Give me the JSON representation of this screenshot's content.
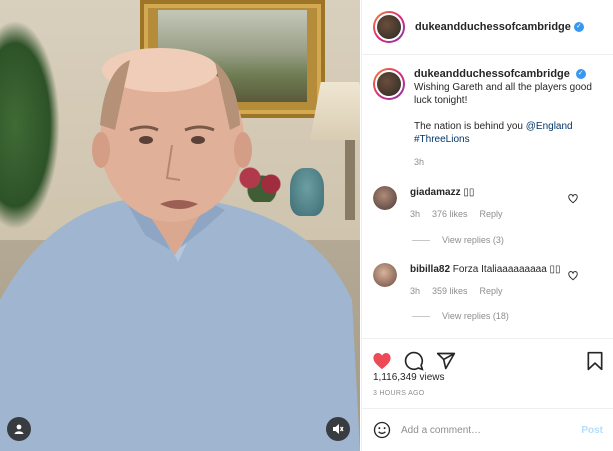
{
  "post": {
    "author": "dukeandduchessofcambridge",
    "caption_line1": "Wishing Gareth and all the players good luck tonight!",
    "caption_line2_text": "The nation is behind you ",
    "caption_mention": "@England",
    "caption_hashtag": "#ThreeLions",
    "caption_time": "3h",
    "views": "1,116,349 views",
    "time_ago": "3 HOURS AGO"
  },
  "comments": [
    {
      "user": "giadamazz",
      "text": "▯▯",
      "time": "3h",
      "likes": "376 likes",
      "reply_label": "Reply",
      "view_replies": "View replies (3)"
    },
    {
      "user": "bibilla82",
      "text": "Forza Italiaaaaaaaaa ▯▯",
      "time": "3h",
      "likes": "359 likes",
      "reply_label": "Reply",
      "view_replies": "View replies (18)"
    }
  ],
  "composer": {
    "placeholder": "Add a comment…",
    "post_label": "Post"
  },
  "icons": {
    "like": "heart-icon",
    "comment": "comment-icon",
    "share": "share-icon",
    "save": "bookmark-icon",
    "emoji": "emoji-icon",
    "user_tag": "user-tag-icon",
    "audio": "muted-audio-icon",
    "verified": "verified-badge-icon"
  },
  "colors": {
    "like_active": "#ed4956",
    "link": "#00376b",
    "verified": "#3897f0",
    "post_disabled": "#b2dffc"
  }
}
